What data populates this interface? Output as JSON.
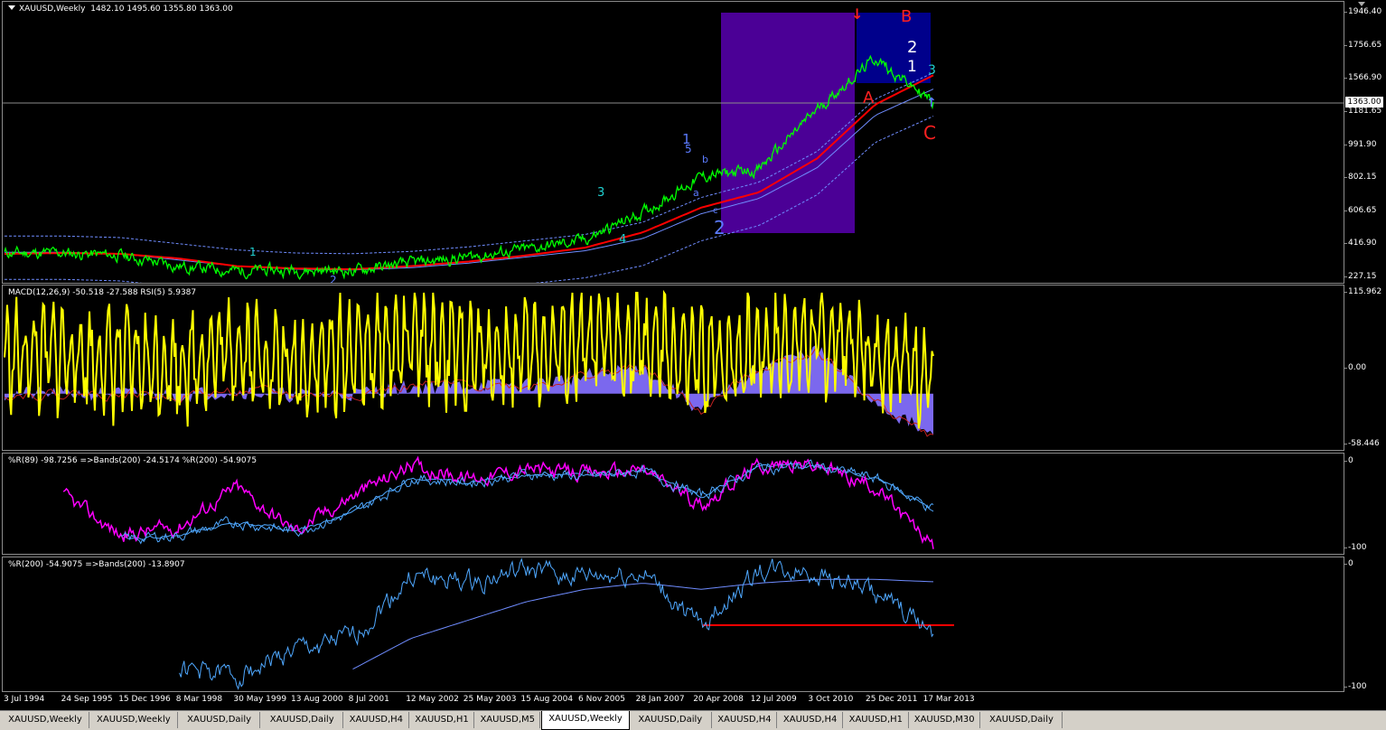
{
  "window": {
    "chart_title": "XAUUSD,Weekly",
    "ohlc": "1482.10 1495.60 1355.80 1363.00",
    "current_price": "1363.00"
  },
  "panes": {
    "main": {
      "y_labels": [
        "1946.40",
        "1756.65",
        "1566.90",
        "1181.65",
        "991.90",
        "802.15",
        "606.65",
        "416.90",
        "227.15"
      ]
    },
    "macd": {
      "title": "MACD(12,26,9) -50.518 -27.588  RSI(5) 5.9387",
      "y_labels": [
        "115.962",
        "0.00",
        "-58.446"
      ]
    },
    "wpr": {
      "title": "%R(89) -98.7256  =>Bands(200) -24.5174  %R(200) -54.9075",
      "y_labels": [
        "0",
        "-100"
      ]
    },
    "wpr200": {
      "title": "%R(200) -54.9075  =>Bands(200) -13.8907",
      "y_labels": [
        "0",
        "-100"
      ]
    }
  },
  "wave_labels": {
    "top_arrow": "↓",
    "b": "B",
    "a": "A",
    "c": "C",
    "w1": "1",
    "w5": "5",
    "wb": "b",
    "wa": "a",
    "w3": "3",
    "w2": "2",
    "w4": "4",
    "c_small": "c",
    "bottom_1": "1",
    "bottom_2": "2",
    "r_2": "2",
    "r_1": "1",
    "r_3": "3",
    "r_arrow": "↑"
  },
  "x_labels": [
    "3 Jul 1994",
    "24 Sep 1995",
    "15 Dec 1996",
    "8 Mar 1998",
    "30 May 1999",
    "13 Aug 2000",
    "8 Jul 2001",
    "12 May 2002",
    "25 May 2003",
    "15 Aug 2004",
    "6 Nov 2005",
    "28 Jan 2007",
    "20 Apr 2008",
    "12 Jul 2009",
    "3 Oct 2010",
    "25 Dec 2011",
    "17 Mar 2013"
  ],
  "tabs": [
    "XAUUSD,Weekly",
    "XAUUSD,Weekly",
    "XAUUSD,Daily",
    "XAUUSD,Daily",
    "XAUUSD,H4",
    "XAUUSD,H1",
    "XAUUSD,M5",
    "XAUUSD,Weekly",
    "XAUUSD,Daily",
    "XAUUSD,H4",
    "XAUUSD,H4",
    "XAUUSD,H1",
    "XAUUSD,M30",
    "XAUUSD,Daily"
  ],
  "active_tab_index": 7,
  "colors": {
    "price": "#00ff00",
    "ma_red": "#ff0000",
    "ma_blue": "#6f8cff",
    "macd_line": "#ffff00",
    "macd_hist": "#7b68ee",
    "wpr89": "#ff00ff",
    "wpr200": "#4fa8ff",
    "box_purple": "#4b0096",
    "box_blue": "#00008b",
    "support_red": "#ff0000"
  },
  "chart_data": [
    {
      "type": "line",
      "pane": "main",
      "x": [
        "3 Jul 1994",
        "24 Sep 1995",
        "15 Dec 1996",
        "8 Mar 1998",
        "30 May 1999",
        "13 Aug 2000",
        "8 Jul 2001",
        "12 May 2002",
        "25 May 2003",
        "15 Aug 2004",
        "6 Nov 2005",
        "28 Jan 2007",
        "20 Apr 2008",
        "12 Jul 2009",
        "3 Oct 2010",
        "25 Dec 2011",
        "17 Mar 2013"
      ],
      "series": [
        {
          "values": [
            385,
            385,
            370,
            300,
            270,
            275,
            270,
            320,
            360,
            410,
            470,
            650,
            880,
            930,
            1320,
            1650,
            1363
          ]
        },
        {
          "values": [
            380,
            385,
            380,
            350,
            300,
            285,
            280,
            300,
            330,
            370,
            420,
            520,
            680,
            780,
            1000,
            1350,
            1540
          ]
        },
        {
          "values": [
            390,
            390,
            380,
            340,
            300,
            280,
            275,
            290,
            320,
            360,
            400,
            480,
            640,
            740,
            940,
            1280,
            1450
          ]
        }
      ],
      "ylim": [
        227.15,
        1946.4
      ]
    },
    {
      "type": "line",
      "pane": "macd",
      "x": [
        "3 Jul 1994",
        "24 Sep 1995",
        "15 Dec 1996",
        "8 Mar 1998",
        "30 May 1999",
        "13 Aug 2000",
        "8 Jul 2001",
        "12 May 2002",
        "25 May 2003",
        "15 Aug 2004",
        "6 Nov 2005",
        "28 Jan 2007",
        "20 Apr 2008",
        "12 Jul 2009",
        "3 Oct 2010",
        "25 Dec 2011",
        "17 Mar 2013"
      ],
      "series": [
        {
          "values": [
            50,
            60,
            40,
            30,
            80,
            20,
            70,
            90,
            60,
            70,
            80,
            90,
            30,
            80,
            100,
            70,
            5.9387
          ]
        },
        {
          "values": [
            0,
            0,
            0,
            -2,
            3,
            -2,
            0,
            8,
            10,
            10,
            20,
            30,
            -20,
            30,
            50,
            -10,
            -50.518
          ]
        }
      ],
      "ylim": [
        -58.446,
        115.962
      ]
    },
    {
      "type": "line",
      "pane": "wpr",
      "x": [
        "3 Jul 1994",
        "24 Sep 1995",
        "15 Dec 1996",
        "8 Mar 1998",
        "30 May 1999",
        "13 Aug 2000",
        "8 Jul 2001",
        "12 May 2002",
        "25 May 2003",
        "15 Aug 2004",
        "6 Nov 2005",
        "28 Jan 2007",
        "20 Apr 2008",
        "12 Jul 2009",
        "3 Oct 2010",
        "25 Dec 2011",
        "17 Mar 2013"
      ],
      "series": [
        {
          "values": [
            null,
            -40,
            -85,
            -75,
            -30,
            -80,
            -40,
            -5,
            -20,
            -10,
            -15,
            -10,
            -50,
            -5,
            -5,
            -30,
            -98.7256
          ]
        },
        {
          "values": [
            null,
            null,
            -90,
            -85,
            -70,
            -80,
            -60,
            -20,
            -25,
            -15,
            -18,
            -12,
            -40,
            -8,
            -6,
            -20,
            -54.9075
          ]
        }
      ],
      "ylim": [
        -100,
        0
      ]
    },
    {
      "type": "line",
      "pane": "wpr200",
      "x": [
        "3 Jul 1994",
        "24 Sep 1995",
        "15 Dec 1996",
        "8 Mar 1998",
        "30 May 1999",
        "13 Aug 2000",
        "8 Jul 2001",
        "12 May 2002",
        "25 May 2003",
        "15 Aug 2004",
        "6 Nov 2005",
        "28 Jan 2007",
        "20 Apr 2008",
        "12 Jul 2009",
        "3 Oct 2010",
        "25 Dec 2011",
        "17 Mar 2013"
      ],
      "series": [
        {
          "values": [
            null,
            null,
            null,
            -85,
            -90,
            -70,
            -60,
            -10,
            -15,
            -5,
            -10,
            -8,
            -50,
            -5,
            -5,
            -25,
            -54.9075
          ]
        },
        {
          "values": [
            null,
            null,
            null,
            null,
            null,
            null,
            -85,
            -60,
            -45,
            -30,
            -20,
            -15,
            -20,
            -15,
            -12,
            -12,
            -13.8907
          ]
        }
      ],
      "ylim": [
        -100,
        0
      ]
    }
  ]
}
